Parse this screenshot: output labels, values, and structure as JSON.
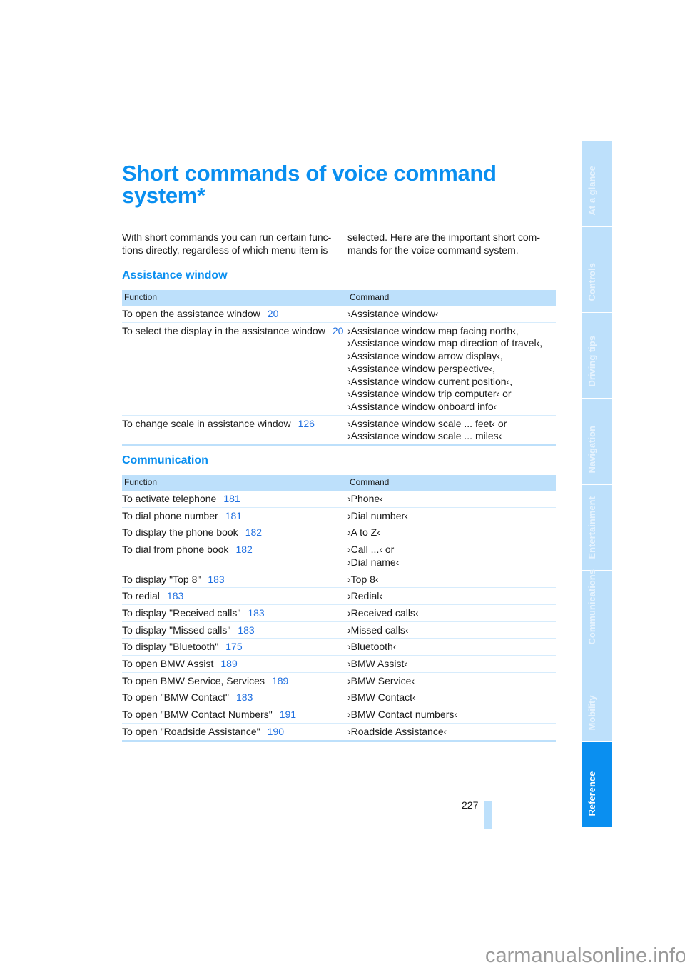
{
  "title": "Short commands of voice command system*",
  "intro": {
    "left": "With short commands you can run certain func-tions directly, regardless of which menu item is",
    "right": "selected. Here are the important short com-mands for the voice command system."
  },
  "sections": [
    {
      "heading": "Assistance window",
      "headers": {
        "function": "Function",
        "command": "Command"
      },
      "rows": [
        {
          "function": "To open the assistance window",
          "page": "20",
          "command": [
            "›Assistance window‹"
          ]
        },
        {
          "function": "To select the display in the assistance window",
          "page": "20",
          "command": [
            "›Assistance window map facing north‹,",
            "›Assistance window map direction of travel‹,",
            "›Assistance window arrow display‹,",
            "›Assistance window perspective‹,",
            "›Assistance window current position‹,",
            "›Assistance window trip computer‹ or",
            "›Assistance window onboard info‹"
          ]
        },
        {
          "function": "To change scale in assistance window",
          "page": "126",
          "command": [
            "›Assistance window scale ... feet‹ or",
            "›Assistance window scale ... miles‹"
          ]
        }
      ]
    },
    {
      "heading": "Communication",
      "headers": {
        "function": "Function",
        "command": "Command"
      },
      "rows": [
        {
          "function": "To activate telephone",
          "page": "181",
          "command": [
            "›Phone‹"
          ]
        },
        {
          "function": "To dial phone number",
          "page": "181",
          "command": [
            "›Dial number‹"
          ]
        },
        {
          "function": "To display the phone book",
          "page": "182",
          "command": [
            "›A to Z‹"
          ]
        },
        {
          "function": "To dial from phone book",
          "page": "182",
          "command": [
            "›Call ...‹ or",
            "›Dial name‹"
          ]
        },
        {
          "function": "To display \"Top 8\"",
          "page": "183",
          "command": [
            "›Top 8‹"
          ]
        },
        {
          "function": "To redial",
          "page": "183",
          "command": [
            "›Redial‹"
          ]
        },
        {
          "function": "To display \"Received calls\"",
          "page": "183",
          "command": [
            "›Received calls‹"
          ]
        },
        {
          "function": "To display \"Missed calls\"",
          "page": "183",
          "command": [
            "›Missed calls‹"
          ]
        },
        {
          "function": "To display \"Bluetooth\"",
          "page": "175",
          "command": [
            "›Bluetooth‹"
          ]
        },
        {
          "function": "To open BMW Assist",
          "page": "189",
          "command": [
            "›BMW Assist‹"
          ]
        },
        {
          "function": "To open BMW Service, Services",
          "page": "189",
          "command": [
            "›BMW Service‹"
          ]
        },
        {
          "function": "To open \"BMW Contact\"",
          "page": "183",
          "command": [
            "›BMW Contact‹"
          ]
        },
        {
          "function": "To open \"BMW Contact Numbers\"",
          "page": "191",
          "command": [
            "›BMW Contact numbers‹"
          ]
        },
        {
          "function": "To open \"Roadside Assistance\"",
          "page": "190",
          "command": [
            "›Roadside Assistance‹"
          ]
        }
      ]
    }
  ],
  "side_tabs": [
    "At a glance",
    "Controls",
    "Driving tips",
    "Navigation",
    "Entertainment",
    "Communications",
    "Mobility",
    "Reference"
  ],
  "active_tab": "Reference",
  "page_number": "227",
  "watermark": "carmanualsonline.info",
  "colors": {
    "accent": "#0a8ff0",
    "light": "#bde0fb",
    "link": "#1f6fe0"
  }
}
